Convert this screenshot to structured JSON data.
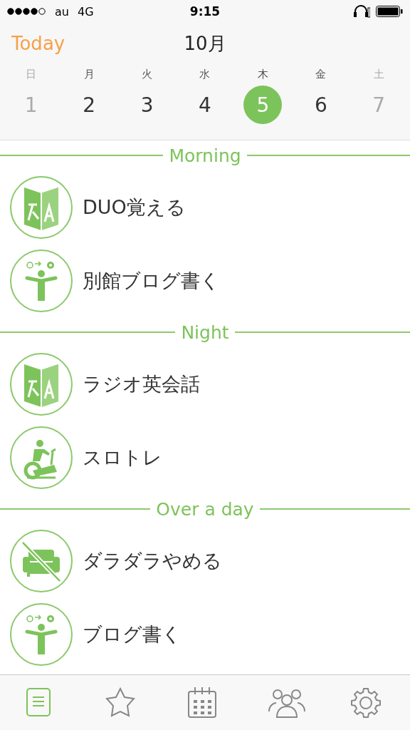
{
  "status_bar": {
    "carrier": "au",
    "network": "4G",
    "time": "9:15"
  },
  "header": {
    "today_button": "Today",
    "month": "10月"
  },
  "week": [
    {
      "weekday": "日",
      "date": "1",
      "dimmed": true,
      "selected": false
    },
    {
      "weekday": "月",
      "date": "2",
      "dimmed": false,
      "selected": false
    },
    {
      "weekday": "火",
      "date": "3",
      "dimmed": false,
      "selected": false
    },
    {
      "weekday": "水",
      "date": "4",
      "dimmed": false,
      "selected": false
    },
    {
      "weekday": "木",
      "date": "5",
      "dimmed": false,
      "selected": true
    },
    {
      "weekday": "金",
      "date": "6",
      "dimmed": false,
      "selected": false
    },
    {
      "weekday": "土",
      "date": "7",
      "dimmed": true,
      "selected": false
    }
  ],
  "sections": [
    {
      "title": "Morning",
      "items": [
        {
          "label": "DUO覚える",
          "kind": "translate"
        },
        {
          "label": "別館ブログ書く",
          "kind": "idea"
        }
      ]
    },
    {
      "title": "Night",
      "items": [
        {
          "label": "ラジオ英会話",
          "kind": "translate"
        },
        {
          "label": "スロトレ",
          "kind": "bike"
        }
      ]
    },
    {
      "title": "Over a day",
      "items": [
        {
          "label": "ダラダラやめる",
          "kind": "sofa"
        },
        {
          "label": "ブログ書く",
          "kind": "idea"
        }
      ]
    }
  ],
  "tab_bar": [
    {
      "kind": "list",
      "selected": true
    },
    {
      "kind": "star",
      "selected": false
    },
    {
      "kind": "calendar",
      "selected": false
    },
    {
      "kind": "people",
      "selected": false
    },
    {
      "kind": "gear",
      "selected": false
    }
  ]
}
